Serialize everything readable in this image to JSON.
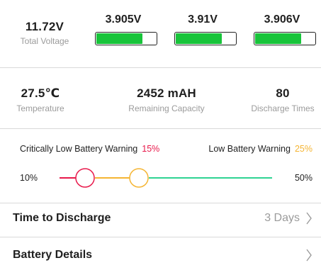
{
  "voltage": {
    "total_value": "11.72V",
    "total_label": "Total Voltage",
    "cells": [
      {
        "value": "3.905V",
        "fill_fraction": 0.78
      },
      {
        "value": "3.91V",
        "fill_fraction": 0.78
      },
      {
        "value": "3.906V",
        "fill_fraction": 0.78
      }
    ],
    "fill_color": "#18c43a"
  },
  "stats": {
    "temperature_value": "27.5℃",
    "temperature_label": "Temperature",
    "capacity_value": "2452 mAH",
    "capacity_label": "Remaining Capacity",
    "discharge_value": "80",
    "discharge_label": "Discharge Times"
  },
  "warnings": {
    "critical_label": "Critically Low Battery Warning",
    "critical_pct": "15%",
    "critical_color": "#e8194b",
    "low_label": "Low Battery Warning",
    "low_pct": "25%",
    "low_color": "#f5b533",
    "range_min": "10%",
    "range_max": "50%",
    "track_color": "#2fd393"
  },
  "rows": {
    "time_to_discharge_label": "Time to Discharge",
    "time_to_discharge_value": "3 Days",
    "battery_details_label": "Battery Details"
  },
  "icons": {
    "chevron": "chevron-right-icon"
  }
}
